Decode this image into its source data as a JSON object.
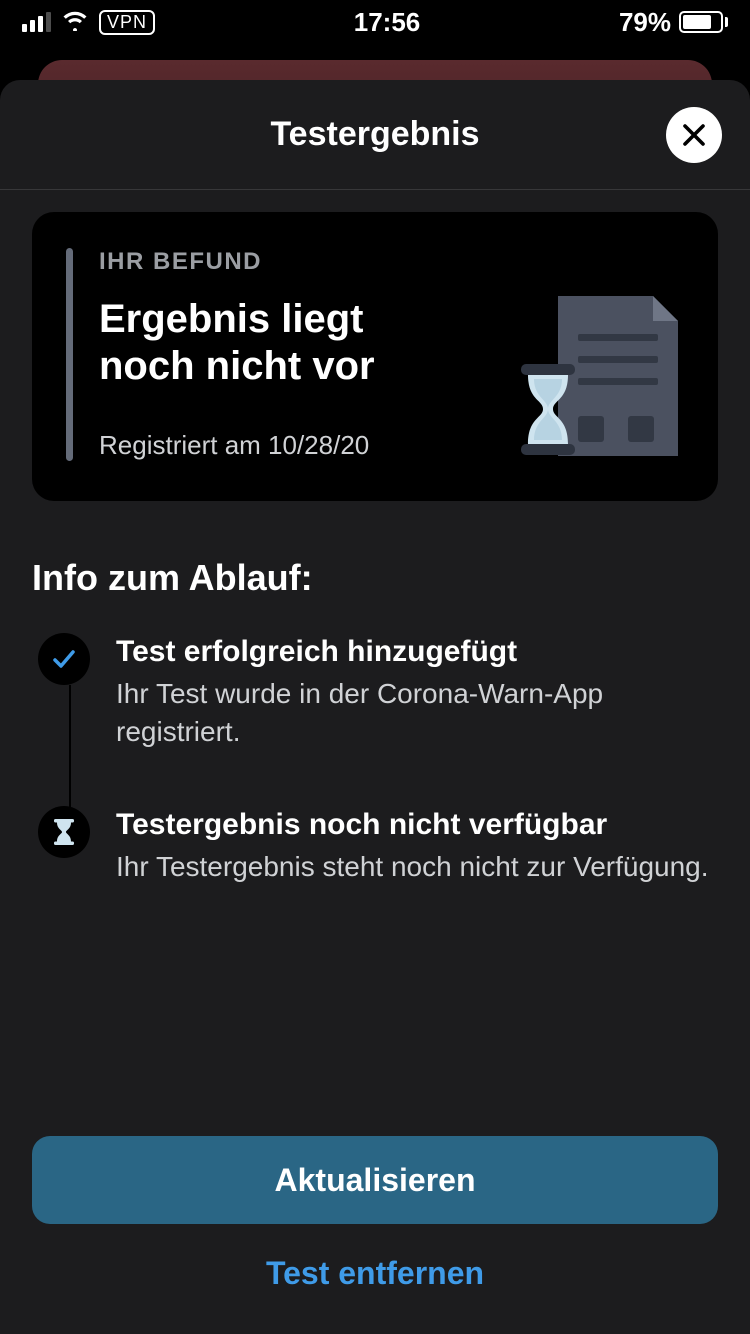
{
  "status_bar": {
    "time": "17:56",
    "vpn": "VPN",
    "battery_pct": "79%",
    "battery_fill_pct": 79
  },
  "sheet": {
    "title": "Testergebnis"
  },
  "card": {
    "eyebrow": "IHR BEFUND",
    "headline": "Ergebnis liegt noch nicht vor",
    "registered": "Registriert am 10/28/20"
  },
  "section_title": "Info zum Ablauf:",
  "steps": [
    {
      "icon": "check",
      "title": "Test erfolgreich hinzugefügt",
      "body": "Ihr Test wurde in der Corona-Warn-App registriert."
    },
    {
      "icon": "hourglass",
      "title": "Testergebnis noch nicht verfügbar",
      "body": "Ihr Testergebnis steht noch nicht zur Verfügung."
    }
  ],
  "buttons": {
    "primary": "Aktualisieren",
    "secondary": "Test entfernen"
  }
}
